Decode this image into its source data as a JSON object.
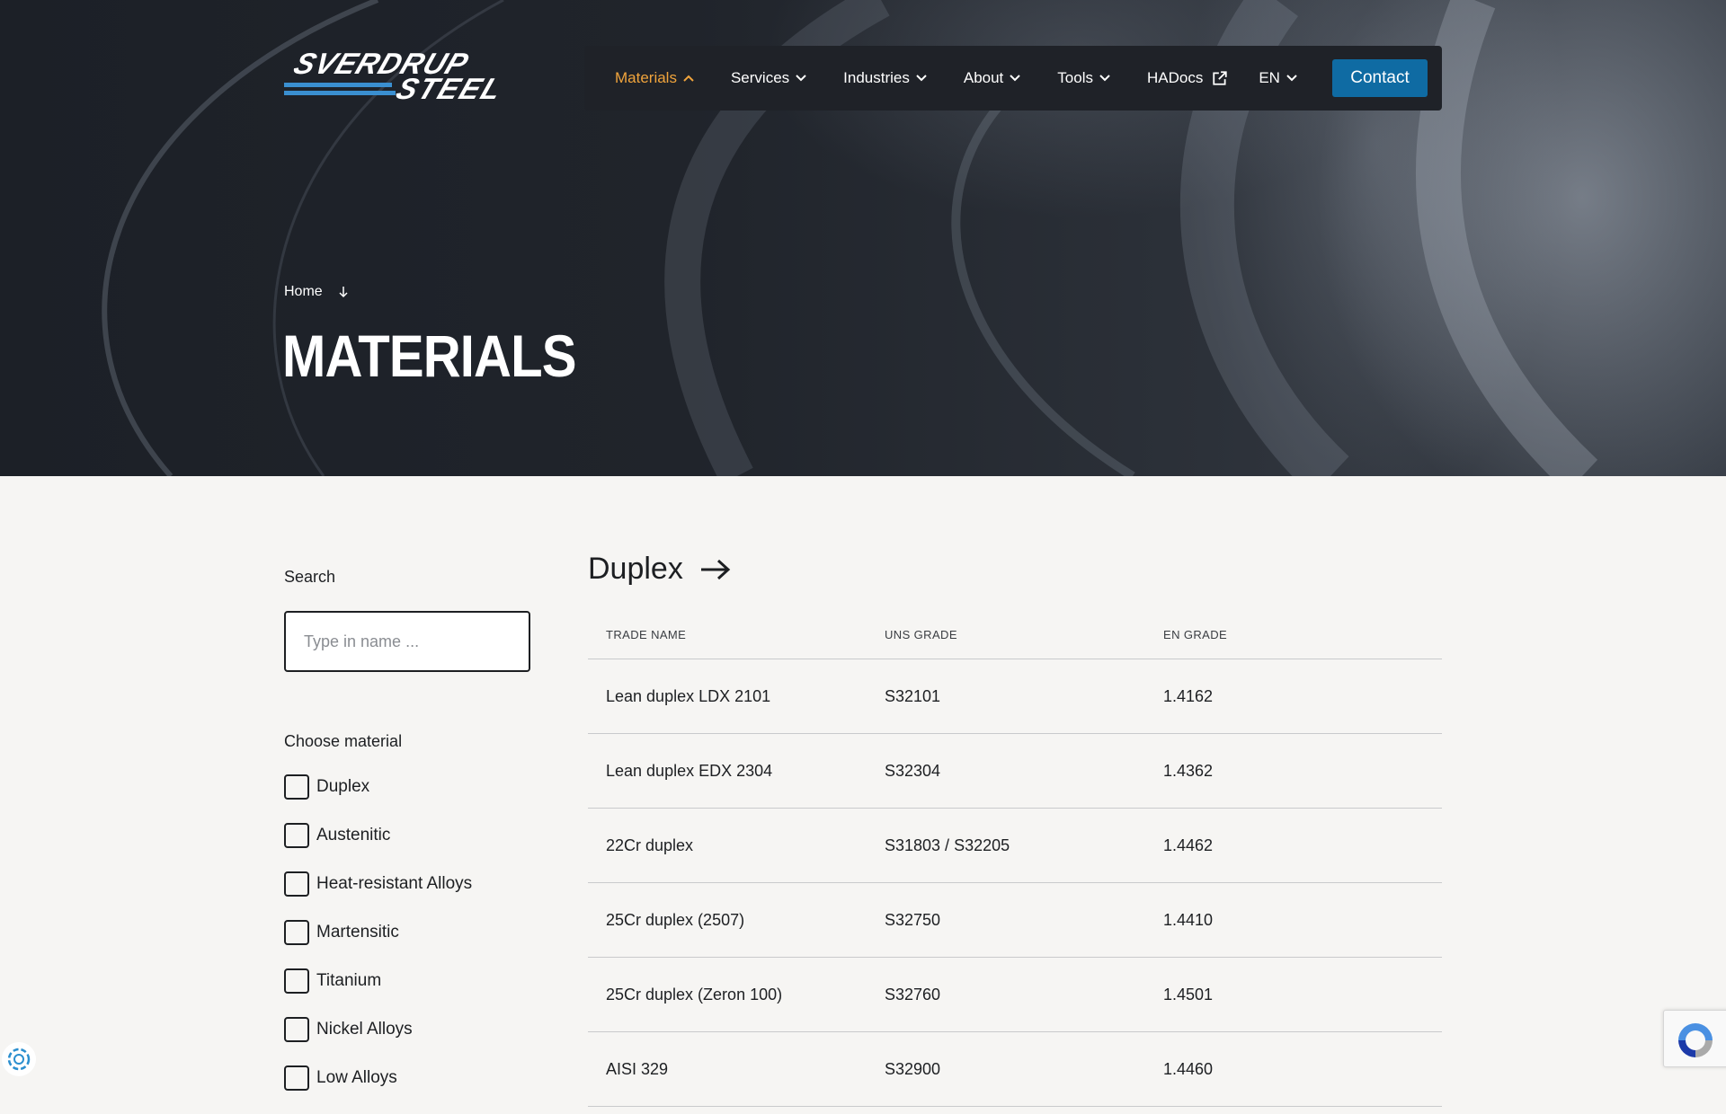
{
  "brand": {
    "logo_line1": "SVERDRUP",
    "logo_line2": "STEEL",
    "accent_color": "#0f6ba3",
    "active_nav_color": "#f0a43c"
  },
  "nav": {
    "items": [
      {
        "label": "Materials",
        "icon": "chevron-up-icon",
        "active": true
      },
      {
        "label": "Services",
        "icon": "chevron-down-icon"
      },
      {
        "label": "Industries",
        "icon": "chevron-down-icon"
      },
      {
        "label": "About",
        "icon": "chevron-down-icon"
      },
      {
        "label": "Tools",
        "icon": "chevron-down-icon"
      },
      {
        "label": "HADocs",
        "icon": "external-link-icon"
      },
      {
        "label": "EN",
        "icon": "chevron-down-icon"
      }
    ],
    "contact_label": "Contact"
  },
  "hero": {
    "breadcrumb_home": "Home",
    "title": "MATERIALS"
  },
  "sidebar": {
    "search_label": "Search",
    "search_placeholder": "Type in name ...",
    "search_value": "",
    "choose_label": "Choose material",
    "materials": [
      {
        "label": "Duplex",
        "checked": false
      },
      {
        "label": "Austenitic",
        "checked": false
      },
      {
        "label": "Heat-resistant Alloys",
        "checked": false
      },
      {
        "label": "Martensitic",
        "checked": false
      },
      {
        "label": "Titanium",
        "checked": false
      },
      {
        "label": "Nickel Alloys",
        "checked": false
      },
      {
        "label": "Low Alloys",
        "checked": false
      }
    ]
  },
  "section": {
    "title": "Duplex",
    "columns": [
      "TRADE NAME",
      "UNS GRADE",
      "EN GRADE"
    ],
    "rows": [
      [
        "Lean duplex LDX 2101",
        "S32101",
        "1.4162"
      ],
      [
        "Lean duplex EDX 2304",
        "S32304",
        "1.4362"
      ],
      [
        "22Cr duplex",
        "S31803 / S32205",
        "1.4462"
      ],
      [
        "25Cr duplex (2507)",
        "S32750",
        "1.4410"
      ],
      [
        "25Cr duplex (Zeron 100)",
        "S32760",
        "1.4501"
      ],
      [
        "AISI 329",
        "S32900",
        "1.4460"
      ]
    ]
  }
}
